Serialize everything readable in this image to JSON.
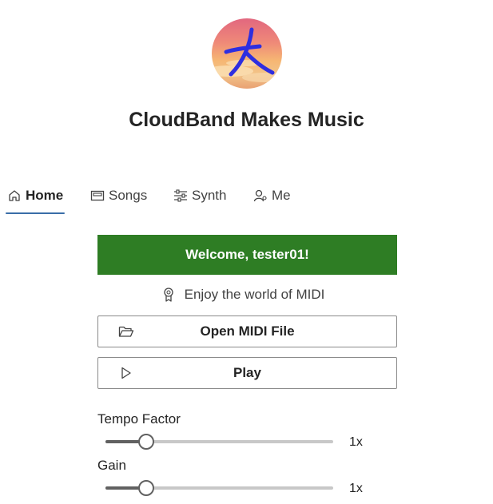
{
  "app": {
    "title": "CloudBand Makes Music"
  },
  "tabs": [
    {
      "label": "Home",
      "icon": "home-icon",
      "active": true
    },
    {
      "label": "Songs",
      "icon": "keyboard-icon",
      "active": false
    },
    {
      "label": "Synth",
      "icon": "sliders-icon",
      "active": false
    },
    {
      "label": "Me",
      "icon": "person-icon",
      "active": false
    }
  ],
  "welcome": {
    "text": "Welcome, tester01!"
  },
  "tagline": {
    "text": "Enjoy the world of MIDI",
    "icon": "ribbon-icon"
  },
  "buttons": {
    "open_midi": {
      "label": "Open MIDI File",
      "icon": "folder-open-icon"
    },
    "play": {
      "label": "Play",
      "icon": "play-icon"
    }
  },
  "controls": {
    "tempo": {
      "label": "Tempo Factor",
      "value_text": "1x",
      "level": 0.18
    },
    "gain": {
      "label": "Gain",
      "value_text": "1x",
      "level": 0.18
    }
  },
  "colors": {
    "accent": "#3a6ea8",
    "welcome_bg": "#2e7d24",
    "text": "#242424"
  }
}
